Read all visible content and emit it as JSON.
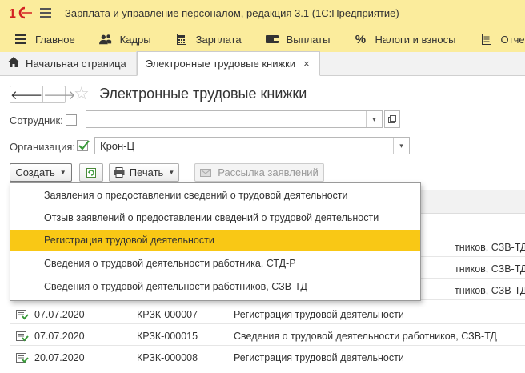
{
  "window": {
    "title": "Зарплата и управление персоналом, редакция 3.1  (1С:Предприятие)"
  },
  "sections": [
    {
      "label": "Главное",
      "icon": "hamburger-icon"
    },
    {
      "label": "Кадры",
      "icon": "people-icon"
    },
    {
      "label": "Зарплата",
      "icon": "calculator-icon"
    },
    {
      "label": "Выплаты",
      "icon": "wallet-icon"
    },
    {
      "label": "Налоги и взносы",
      "icon": "percent-icon"
    },
    {
      "label": "Отчеты",
      "icon": "report-icon"
    }
  ],
  "tabs": {
    "home": "Начальная страница",
    "active": "Электронные трудовые книжки",
    "close": "×"
  },
  "form": {
    "title": "Электронные трудовые книжки",
    "employee_label": "Сотрудник:",
    "employee_checked": false,
    "employee_value": "",
    "organization_label": "Организация:",
    "organization_checked": true,
    "organization_value": "Крон-Ц"
  },
  "commands": {
    "create": "Создать",
    "print": "Печать",
    "mailing": "Рассылка заявлений"
  },
  "create_menu": {
    "items": [
      "Заявления о предоставлении сведений о трудовой деятельности",
      "Отзыв заявлений о предоставлении сведений о трудовой деятельности",
      "Регистрация трудовой деятельности",
      "Сведения о трудовой деятельности работника, СТД-Р",
      "Сведения о трудовой деятельности работников, СЗВ-ТД"
    ],
    "highlighted_index": 2
  },
  "table": {
    "partial_rows": [
      {
        "kind": "тников, СЗВ-ТД"
      },
      {
        "kind": "тников, СЗВ-ТД"
      },
      {
        "kind": "тников, СЗВ-ТД"
      }
    ],
    "rows": [
      {
        "date": "07.07.2020",
        "number": "КРЗК-000007",
        "kind": "Регистрация трудовой деятельности"
      },
      {
        "date": "07.07.2020",
        "number": "КРЗК-000015",
        "kind": "Сведения о трудовой деятельности работников, СЗВ-ТД"
      },
      {
        "date": "20.07.2020",
        "number": "КРЗК-000008",
        "kind": "Регистрация трудовой деятельности"
      }
    ]
  },
  "colors": {
    "section_bg": "#fbec9c",
    "highlight": "#f9c815",
    "logo_red": "#d32222",
    "check_green": "#3a9a3a"
  }
}
